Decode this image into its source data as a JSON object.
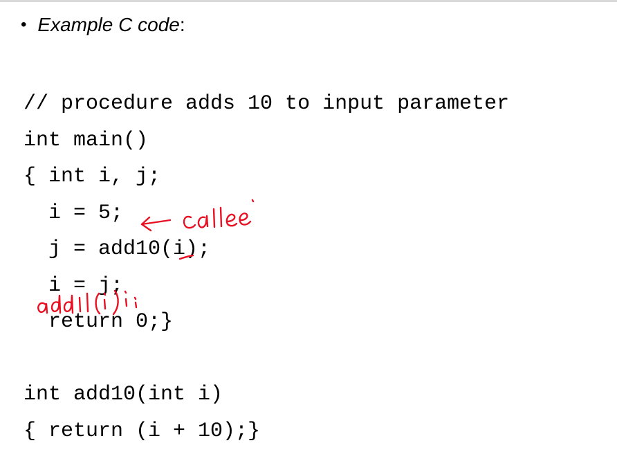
{
  "slide": {
    "bullet": {
      "label": "Example C code",
      "suffix": ":"
    },
    "code_lines": [
      "// procedure adds 10 to input parameter",
      "int main()",
      "{ int i, j;",
      "  i = 5;",
      "  j = add10(i);",
      "  i = j;",
      "  return 0;}",
      "",
      "int add10(int i)",
      "{ return (i + 10);}"
    ],
    "annotations": {
      "callee_note": "callee",
      "call_note": "add10(i);",
      "ink_color": "#e81123"
    }
  }
}
